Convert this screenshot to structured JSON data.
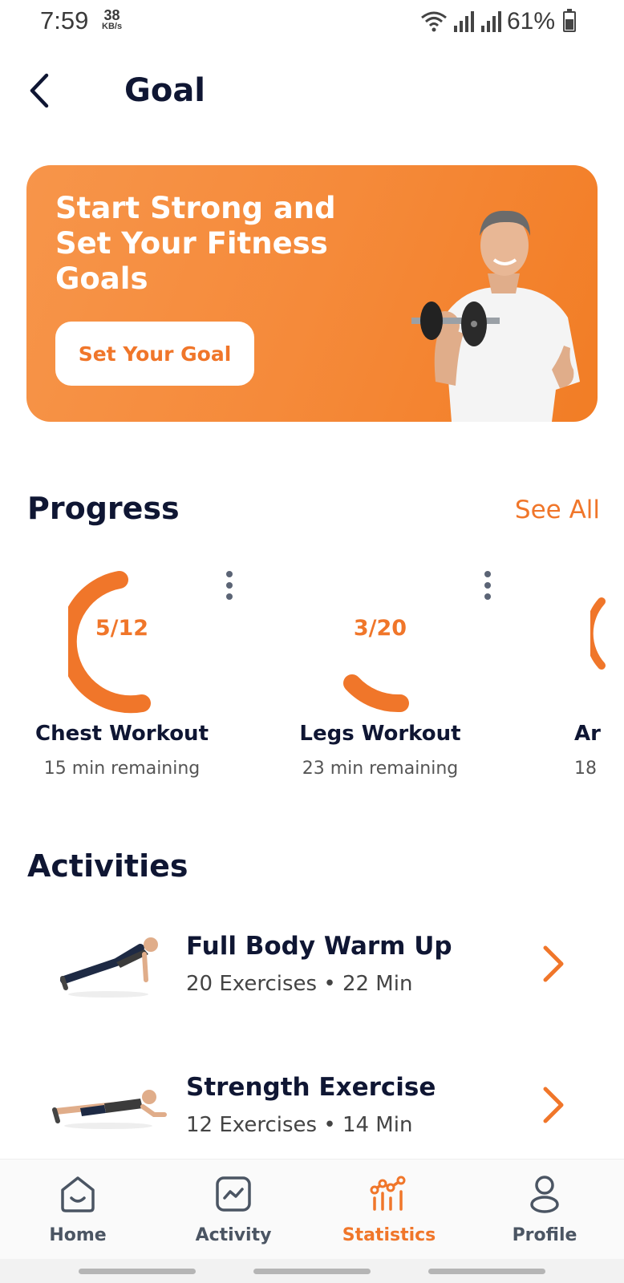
{
  "status_bar": {
    "time": "7:59",
    "speed_value": "38",
    "speed_unit": "KB/s",
    "battery": "61%"
  },
  "header": {
    "title": "Goal"
  },
  "hero": {
    "title": "Start Strong and Set Your Fitness Goals",
    "button_label": "Set Your Goal"
  },
  "progress": {
    "title": "Progress",
    "see_all_label": "See All",
    "items": [
      {
        "count": "5/12",
        "name": "Chest Workout",
        "remaining": "15 min remaining",
        "done": 5,
        "total": 12
      },
      {
        "count": "3/20",
        "name": "Legs Workout",
        "remaining": "23 min remaining",
        "done": 3,
        "total": 20
      },
      {
        "count": "",
        "name": "Ar",
        "remaining": "18"
      }
    ]
  },
  "activities": {
    "title": "Activities",
    "items": [
      {
        "title": "Full Body Warm Up",
        "meta": "20 Exercises • 22 Min"
      },
      {
        "title": "Strength Exercise",
        "meta": "12 Exercises • 14 Min"
      }
    ]
  },
  "bottom_nav": {
    "items": [
      {
        "label": "Home",
        "icon": "home-icon"
      },
      {
        "label": "Activity",
        "icon": "activity-icon"
      },
      {
        "label": "Statistics",
        "icon": "statistics-icon"
      },
      {
        "label": "Profile",
        "icon": "profile-icon"
      }
    ],
    "active": "Statistics"
  },
  "colors": {
    "accent": "#f0762a",
    "hero_bg": "#f58a3a",
    "title_text": "#0f1633"
  }
}
